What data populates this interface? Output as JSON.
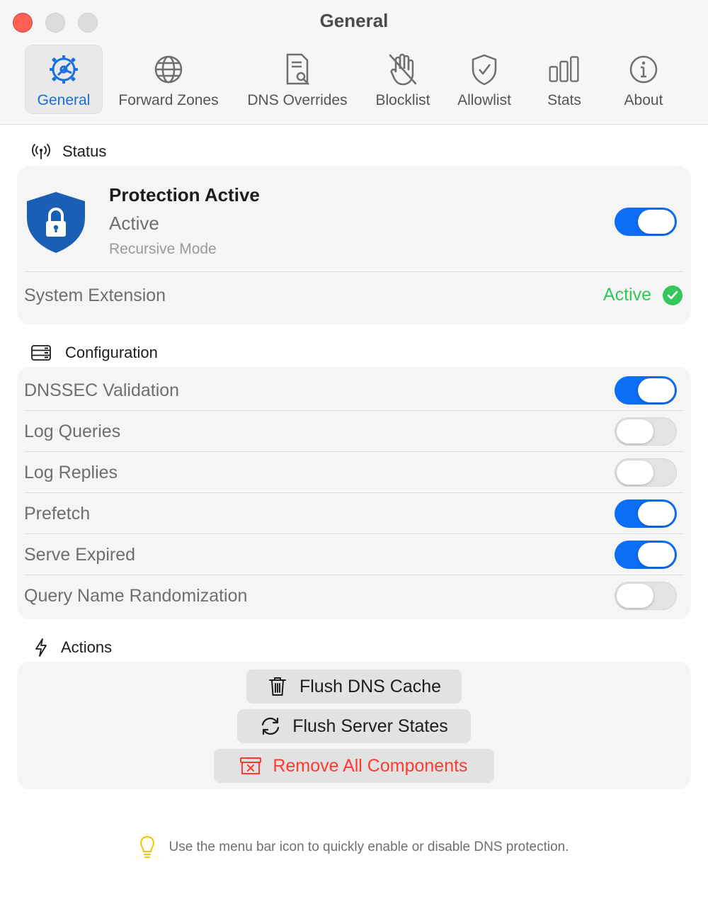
{
  "window": {
    "title": "General"
  },
  "toolbar": {
    "items": [
      {
        "label": "General",
        "icon": "gear-icon",
        "active": true
      },
      {
        "label": "Forward Zones",
        "icon": "globe-icon",
        "active": false
      },
      {
        "label": "DNS Overrides",
        "icon": "document-search-icon",
        "active": false
      },
      {
        "label": "Blocklist",
        "icon": "hand-icon",
        "active": false
      },
      {
        "label": "Allowlist",
        "icon": "shield-check-icon",
        "active": false
      },
      {
        "label": "Stats",
        "icon": "bar-chart-icon",
        "active": false
      },
      {
        "label": "About",
        "icon": "info-icon",
        "active": false
      }
    ]
  },
  "status": {
    "header": "Status",
    "protection_title": "Protection Active",
    "protection_state": "Active",
    "mode": "Recursive Mode",
    "protection_enabled": true,
    "system_extension_label": "System Extension",
    "system_extension_status": "Active"
  },
  "configuration": {
    "header": "Configuration",
    "options": [
      {
        "label": "DNSSEC Validation",
        "enabled": true
      },
      {
        "label": "Log Queries",
        "enabled": false
      },
      {
        "label": "Log Replies",
        "enabled": false
      },
      {
        "label": "Prefetch",
        "enabled": true
      },
      {
        "label": "Serve Expired",
        "enabled": true
      },
      {
        "label": "Query Name Randomization",
        "enabled": false
      }
    ]
  },
  "actions": {
    "header": "Actions",
    "flush_dns_cache": "Flush DNS Cache",
    "flush_server_states": "Flush Server States",
    "remove_all_components": "Remove All Components"
  },
  "hint": "Use the menu bar icon to quickly enable or disable DNS protection.",
  "colors": {
    "accent": "#0b6ef5",
    "success": "#34c759",
    "danger": "#ff3b30",
    "shield": "#1a5fb4"
  }
}
